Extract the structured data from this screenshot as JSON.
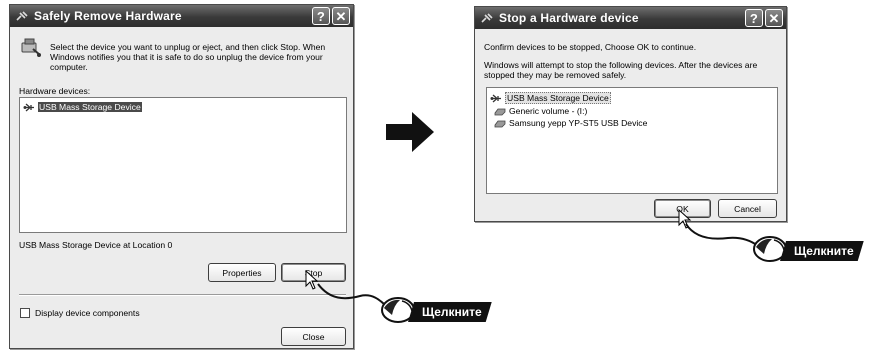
{
  "dialog1": {
    "title": "Safely Remove Hardware",
    "help": "?",
    "close_x": "✕",
    "instructions": "Select the device you want to unplug or eject, and then click Stop. When\nWindows notifies you that it is safe to do so unplug the device from your\ncomputer.",
    "list_label": "Hardware devices:",
    "devices": [
      "USB Mass Storage Device"
    ],
    "location_text": "USB Mass Storage Device at Location 0",
    "properties_label": "Properties",
    "stop_label": "Stop",
    "display_components_label": "Display device components",
    "close_label": "Close"
  },
  "dialog2": {
    "title": "Stop a Hardware device",
    "help": "?",
    "close_x": "✕",
    "confirm_text": "Confirm devices to be stopped, Choose OK to continue.",
    "info_text": "Windows will attempt to stop the following devices. After the devices are\nstopped they may be removed safely.",
    "devices": [
      "USB Mass Storage Device",
      "Generic volume - (I:)",
      "Samsung yepp YP-ST5 USB Device"
    ],
    "ok_label": "OK",
    "cancel_label": "Cancel"
  },
  "callouts": {
    "click_1": "Щелкните",
    "click_2": "Щелкните"
  },
  "icons": {
    "dialog_icon": "usb-plug-icon",
    "device_icon": "usb-device-icon",
    "drive_icon": "disk-drive-icon",
    "arrow": "right-arrow-icon",
    "mouse": "mouse-icon"
  }
}
